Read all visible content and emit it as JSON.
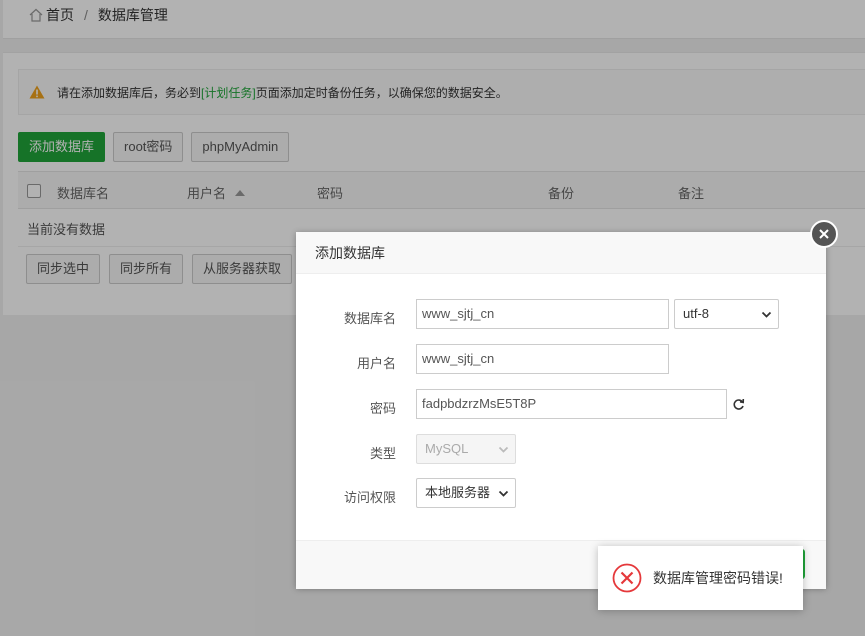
{
  "breadcrumb": {
    "home": "首页",
    "separator": "/",
    "current": "数据库管理"
  },
  "alert": {
    "prefix": "请在添加数据库后，务必到",
    "link": "[计划任务]",
    "suffix": "页面添加定时备份任务，以确保您的数据安全。"
  },
  "toolbar": {
    "add": "添加数据库",
    "root_password": "root密码",
    "phpmyadmin": "phpMyAdmin"
  },
  "table": {
    "columns": [
      "数据库名",
      "用户名",
      "密码",
      "备份",
      "备注"
    ],
    "empty": "当前没有数据"
  },
  "bottom_actions": {
    "sync_selected": "同步选中",
    "sync_all": "同步所有",
    "fetch_server": "从服务器获取"
  },
  "modal": {
    "title": "添加数据库",
    "labels": {
      "db_name": "数据库名",
      "username": "用户名",
      "password": "密码",
      "type": "类型",
      "access": "访问权限"
    },
    "values": {
      "db_name": "www_sjtj_cn",
      "charset": "utf-8",
      "username": "www_sjtj_cn",
      "password": "fadpbdzrzMsE5T8P",
      "type": "MySQL",
      "access": "本地服务器"
    }
  },
  "toast": {
    "message": "数据库管理密码错误!"
  },
  "colors": {
    "accent": "#20a53a",
    "error": "#e5383b",
    "warning": "#f0a31e"
  },
  "icons": [
    "home-icon",
    "warning-icon",
    "sort-up-icon",
    "close-icon",
    "refresh-icon",
    "chevron-down-icon",
    "error-icon"
  ]
}
